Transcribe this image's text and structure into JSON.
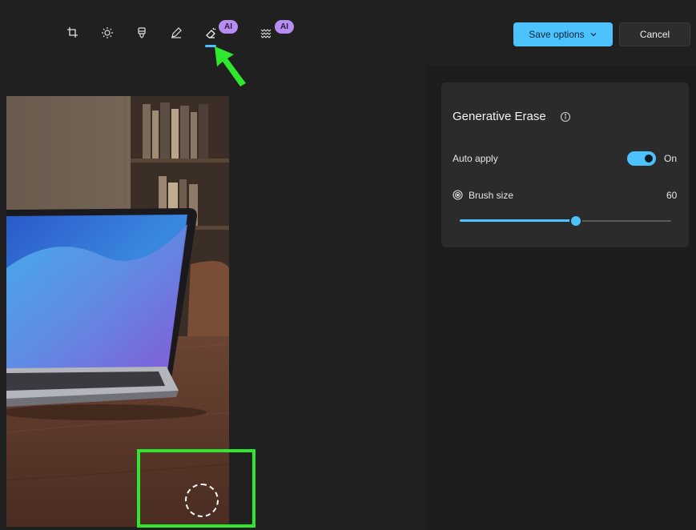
{
  "toolbar": {
    "tools": [
      {
        "name": "crop",
        "icon": "crop-icon"
      },
      {
        "name": "adjust",
        "icon": "brightness-icon"
      },
      {
        "name": "filter",
        "icon": "filter-icon"
      },
      {
        "name": "markup",
        "icon": "pen-icon"
      },
      {
        "name": "generative-erase",
        "icon": "eraser-icon",
        "badge": "AI",
        "active": true
      },
      {
        "name": "background",
        "icon": "background-icon",
        "badge": "AI"
      }
    ],
    "save_label": "Save options",
    "save_chevron": "⌄",
    "cancel_label": "Cancel"
  },
  "panel": {
    "title": "Generative Erase",
    "info_icon": "info-icon",
    "auto_apply": {
      "label": "Auto apply",
      "state": "On",
      "enabled": true
    },
    "brush": {
      "label": "Brush size",
      "value": "60",
      "fraction": 0.55
    }
  },
  "colors": {
    "accent": "#4cc2ff",
    "ai_badge": "#b58ef0",
    "highlight": "#2ee82e"
  }
}
